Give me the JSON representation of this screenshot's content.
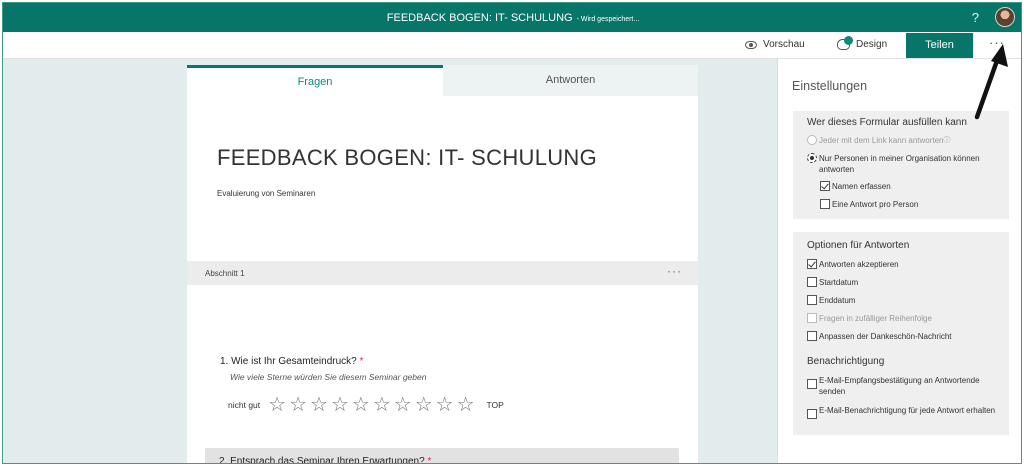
{
  "topbar": {
    "title": "FEEDBACK BOGEN: IT- SCHULUNG",
    "saving": "- Wird gespeichert...",
    "help": "?"
  },
  "commandbar": {
    "preview_label": "Vorschau",
    "design_label": "Design",
    "share_label": "Teilen",
    "more_label": "···"
  },
  "tabs": [
    {
      "label": "Fragen",
      "active": true
    },
    {
      "label": "Antworten",
      "active": false
    }
  ],
  "form": {
    "title": "FEEDBACK BOGEN: IT- SCHULUNG",
    "subtitle": "Evaluierung von Seminaren",
    "section_label": "Abschnitt 1",
    "section_more": "···",
    "questions": [
      {
        "number_text": "1. Wie ist Ihr Gesamteindruck?",
        "required": "*",
        "subtitle": "Wie viele Sterne würden Sie diesem Seminar geben",
        "low_label": "nicht gut",
        "high_label": "TOP",
        "stars": 10
      },
      {
        "number_text": "2. Entsprach das Seminar Ihren Erwartungen?",
        "required": "*"
      }
    ]
  },
  "settings": {
    "heading": "Einstellungen",
    "who_title": "Wer dieses Formular ausfüllen kann",
    "who_options": [
      {
        "label": "Jeder mit dem Link kann antworten",
        "selected": false
      },
      {
        "label": "Nur Personen in meiner Organisation können antworten",
        "selected": true
      }
    ],
    "who_suboptions": [
      {
        "label": "Namen erfassen",
        "checked": true
      },
      {
        "label": "Eine Antwort pro Person",
        "checked": false
      }
    ],
    "response_title": "Optionen für Antworten",
    "response_options": [
      {
        "label": "Antworten akzeptieren",
        "checked": true,
        "enabled": true
      },
      {
        "label": "Startdatum",
        "checked": false,
        "enabled": true
      },
      {
        "label": "Enddatum",
        "checked": false,
        "enabled": true
      },
      {
        "label": "Fragen in zufälliger Reihenfolge",
        "checked": false,
        "enabled": false
      },
      {
        "label": "Anpassen der Dankeschön-Nachricht",
        "checked": false,
        "enabled": true
      }
    ],
    "notify_title": "Benachrichtigung",
    "notify_options": [
      {
        "label": "E-Mail-Empfangsbestätigung an Antwortende senden",
        "checked": false
      },
      {
        "label": "E-Mail-Benachrichtigung für jede Antwort erhalten",
        "checked": false
      }
    ]
  },
  "colors": {
    "brand": "#077568",
    "accent": "#0b8a7a",
    "required": "#c4314b"
  }
}
